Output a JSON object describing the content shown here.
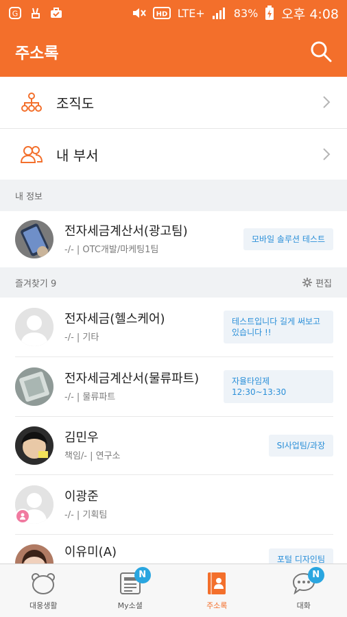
{
  "statusbar": {
    "network": "LTE+",
    "battery": "83%",
    "time": "오후 4:08"
  },
  "appbar": {
    "title": "주소록"
  },
  "quick": [
    {
      "label": "조직도",
      "icon": "org-chart-icon"
    },
    {
      "label": "내 부서",
      "icon": "department-people-icon"
    }
  ],
  "my_info": {
    "header": "내 정보",
    "contact": {
      "name": "전자세금계산서(광고팀)",
      "sub": "-/- | OTC개발/마케팅1팀",
      "status": "모바일 솔루션 테스트"
    }
  },
  "favorites": {
    "header": "즐겨찾기 9",
    "edit_label": "편집",
    "contacts": [
      {
        "name": "전자세금(헬스케어)",
        "sub": "-/- | 기타",
        "status": "테스트입니다 길게 써보고있습니다 !!"
      },
      {
        "name": "전자세금계산서(물류파트)",
        "sub": "-/- | 물류파트",
        "status": "자율타임제 12:30~13:30"
      },
      {
        "name": "김민우",
        "sub": "책임/- | 연구소",
        "status": "SI사업팀/과장"
      },
      {
        "name": "이광준",
        "sub": "-/- | 기획팀",
        "status": ""
      },
      {
        "name": "이유미(A)",
        "sub": "",
        "status": "포털 디자인팀"
      }
    ]
  },
  "bottomnav": {
    "items": [
      {
        "label": "대웅생활",
        "icon": "bear-face-icon",
        "badge": ""
      },
      {
        "label": "My소셜",
        "icon": "social-card-icon",
        "badge": "N"
      },
      {
        "label": "주소록",
        "icon": "address-book-icon",
        "badge": ""
      },
      {
        "label": "대화",
        "icon": "chat-bubble-icon",
        "badge": "N"
      }
    ]
  },
  "colors": {
    "accent": "#f36f2b",
    "status_text": "#2a8fd8",
    "badge": "#2aa6e0"
  }
}
